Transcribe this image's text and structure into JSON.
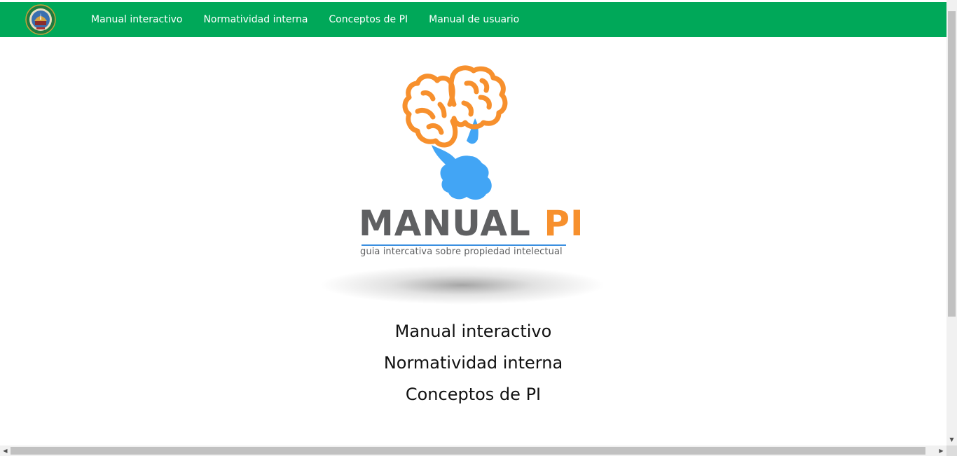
{
  "navbar": {
    "background": "#00a859",
    "logo_icon": "university-seal-icon",
    "links": [
      {
        "label": "Manual interactivo"
      },
      {
        "label": "Normatividad interna"
      },
      {
        "label": "Conceptos de PI"
      },
      {
        "label": "Manual de usuario"
      }
    ]
  },
  "brand": {
    "icon": "brain-lightbulb-icon",
    "title_main": "MANUAL",
    "title_accent": "PI",
    "subtitle": "guia intercativa sobre propiedad intelectual",
    "colors": {
      "gray": "#5f6062",
      "orange": "#f7902d",
      "blue": "#42a5f5"
    }
  },
  "menu": {
    "links": [
      {
        "label": "Manual interactivo"
      },
      {
        "label": "Normatividad interna"
      },
      {
        "label": "Conceptos de PI"
      }
    ]
  }
}
